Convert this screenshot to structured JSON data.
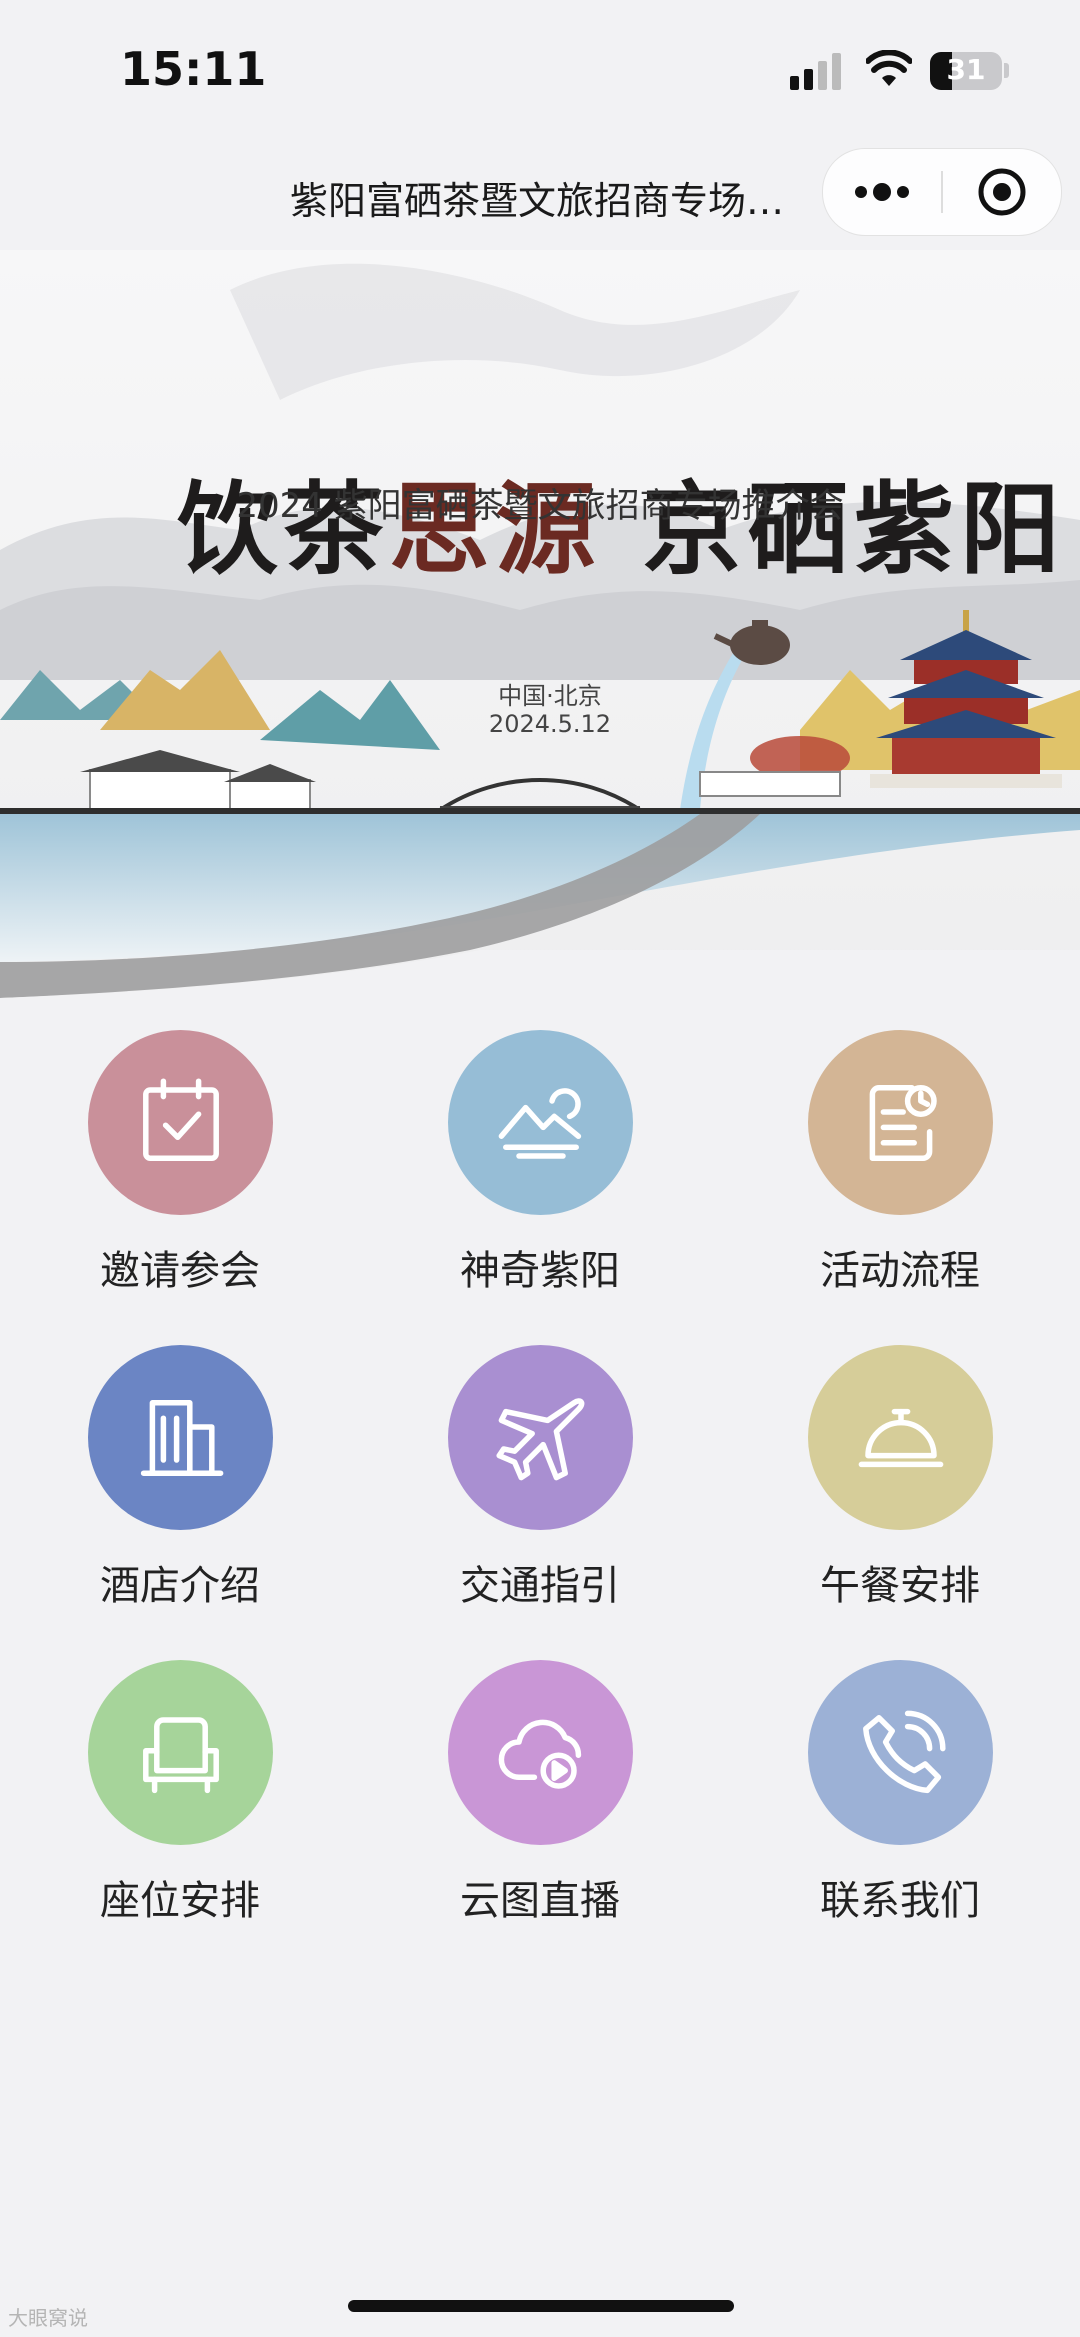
{
  "status_bar": {
    "time": "15:11",
    "battery": "31"
  },
  "nav": {
    "title": "紫阳富硒茶暨文旅招商专场推介会"
  },
  "banner": {
    "title_part1": "饮茶",
    "title_part2": "思源",
    "title_part3": "京",
    "title_part4": "硒紫阳",
    "subtitle": "2024 紫阳富硒茶暨文旅招商专场推介会",
    "place": "中国·北京",
    "date": "2024.5.12"
  },
  "menu": {
    "items": [
      {
        "label": "邀请参会",
        "icon": "calendar-check-icon",
        "color": "#c9909a"
      },
      {
        "label": "神奇紫阳",
        "icon": "mountain-sun-icon",
        "color": "#96bdd6"
      },
      {
        "label": "活动流程",
        "icon": "document-clock-icon",
        "color": "#d3b595"
      },
      {
        "label": "酒店介绍",
        "icon": "building-icon",
        "color": "#6b85c4"
      },
      {
        "label": "交通指引",
        "icon": "airplane-icon",
        "color": "#a98fd1"
      },
      {
        "label": "午餐安排",
        "icon": "food-cloche-icon",
        "color": "#d6cd99"
      },
      {
        "label": "座位安排",
        "icon": "armchair-icon",
        "color": "#a6d49a"
      },
      {
        "label": "云图直播",
        "icon": "cloud-play-icon",
        "color": "#c996d6"
      },
      {
        "label": "联系我们",
        "icon": "phone-icon",
        "color": "#9cb1d6"
      }
    ]
  },
  "watermark": "大眼窝说"
}
